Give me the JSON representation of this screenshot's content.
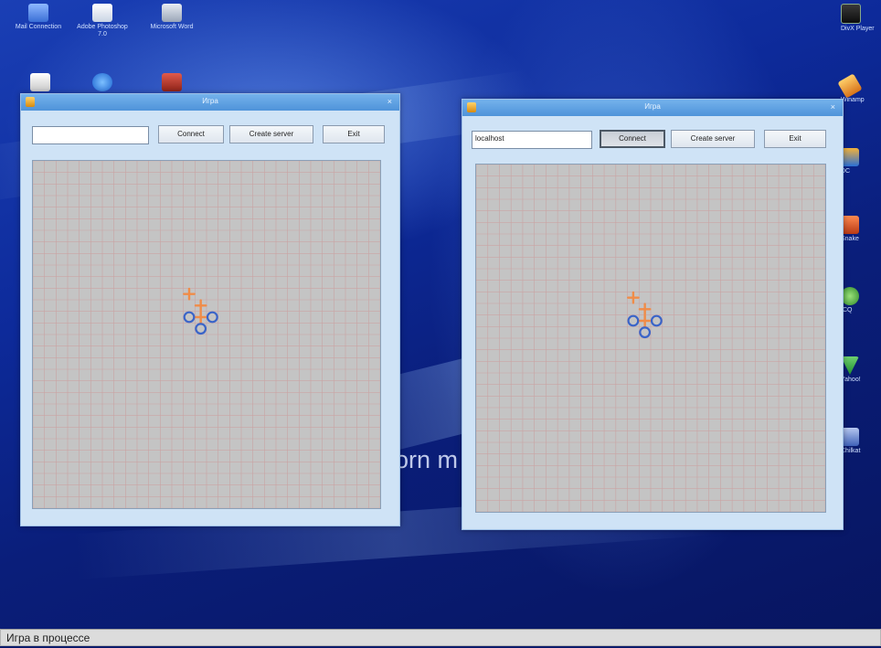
{
  "desktop": {
    "icons": [
      {
        "name": "network-connections-icon",
        "label": "Mail Connection",
        "glyph_color": "#6aa0ff"
      },
      {
        "name": "adobe-photoshop-icon",
        "label": "Adobe Photoshop 7.0",
        "glyph_color": "#f2f2f2"
      },
      {
        "name": "microsoft-word-icon",
        "label": "Microsoft Word",
        "glyph_color": "#d8dce4"
      },
      {
        "name": "msn-icon",
        "label": "",
        "glyph_color": "#e7e7e7"
      },
      {
        "name": "internet-explorer-icon",
        "label": "",
        "glyph_color": "#3a8ef0"
      },
      {
        "name": "winrar-icon",
        "label": "",
        "glyph_color": "#c0392b"
      }
    ],
    "side_icons": [
      {
        "name": "divx-player-icon",
        "label": "DivX Player",
        "glyph_color": "#222222"
      },
      {
        "name": "winamp-icon",
        "label": "Winamp",
        "glyph_color": "#f0a030"
      },
      {
        "name": "dc-icon",
        "label": "DC",
        "glyph_color": "#2a6fd6"
      },
      {
        "name": "game-icon",
        "label": "Snake",
        "glyph_color": "#e8632a"
      },
      {
        "name": "icq-icon",
        "label": "ICQ",
        "glyph_color": "#58b848"
      },
      {
        "name": "yahoo-icon",
        "label": "Yahoo!",
        "glyph_color": "#4caf50"
      },
      {
        "name": "chilkat-icon",
        "label": "Chilkat",
        "glyph_color": "#6a8fdc"
      }
    ],
    "background_text": "orn m"
  },
  "windows": [
    {
      "title": "Игра",
      "address_value": "",
      "connect_label": "Connect",
      "create_server_label": "Create server",
      "exit_label": "Exit",
      "connect_pressed": false
    },
    {
      "title": "Игра",
      "address_value": "localhost",
      "connect_label": "Connect",
      "create_server_label": "Create server",
      "exit_label": "Exit",
      "connect_pressed": true
    }
  ],
  "board": {
    "grid_size": 30,
    "cross_color": "#f08c48",
    "circle_color": "#3a64c8",
    "grid_color": "#c9a4a4",
    "background_color": "#c4c4c4",
    "moves": [
      {
        "type": "X",
        "col": 13,
        "row": 11
      },
      {
        "type": "X",
        "col": 14,
        "row": 12
      },
      {
        "type": "X",
        "col": 14,
        "row": 13
      },
      {
        "type": "O",
        "col": 13,
        "row": 13
      },
      {
        "type": "O",
        "col": 15,
        "row": 13
      },
      {
        "type": "O",
        "col": 14,
        "row": 14
      }
    ]
  },
  "caption": "Игра в процессе"
}
